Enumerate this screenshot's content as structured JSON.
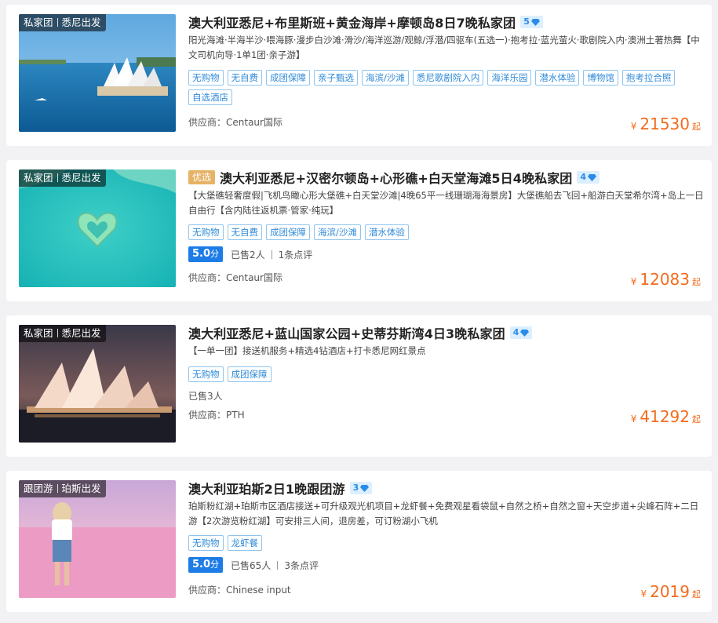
{
  "tours": [
    {
      "tag_type": "私家团",
      "tag_from": "悉尼出发",
      "title": "澳大利亚悉尼+布里斯班+黄金海岸+摩顿岛8日7晚私家团",
      "featured_label": "",
      "diamond": "5",
      "description": "阳光海滩·半海半沙·喂海豚·漫步白沙滩·滑沙/海洋巡游/观鲸/浮潜/四驱车(五选一)·抱考拉·蓝光萤火·歌剧院入内·澳洲土著热舞【中文司机向导·1单1团·亲子游】",
      "chips": [
        "无购物",
        "无自费",
        "成团保障",
        "亲子甄选",
        "海滨/沙滩",
        "悉尼歌剧院入内",
        "海洋乐园",
        "潜水体验",
        "博物馆",
        "抱考拉合照",
        "自选酒店"
      ],
      "score": "",
      "sold": "",
      "reviews": "",
      "supplier": "供应商：Centaur国际",
      "currency": "¥",
      "price": "21530",
      "price_suffix": "起"
    },
    {
      "tag_type": "私家团",
      "tag_from": "悉尼出发",
      "title": "澳大利亚悉尼+汉密尔顿岛+心形礁+白天堂海滩5日4晚私家团",
      "featured_label": "优选",
      "diamond": "4",
      "description": "【大堡礁轻奢度假|飞机鸟瞰心形大堡礁+白天堂沙滩|4晚65平一线珊瑚海海景房】大堡礁船去飞回+船游白天堂希尔湾+岛上一日自由行【含内陆往返机票·管家·纯玩】",
      "chips": [
        "无购物",
        "无自费",
        "成团保障",
        "海滨/沙滩",
        "潜水体验"
      ],
      "score": "5.0",
      "score_unit": "分",
      "sold": "已售2人",
      "reviews": "1条点评",
      "supplier": "供应商：Centaur国际",
      "currency": "¥",
      "price": "12083",
      "price_suffix": "起"
    },
    {
      "tag_type": "私家团",
      "tag_from": "悉尼出发",
      "title": "澳大利亚悉尼+蓝山国家公园+史蒂芬斯湾4日3晚私家团",
      "featured_label": "",
      "diamond": "4",
      "description": "【一单一团】接送机服务+精选4钻酒店+打卡悉尼网红景点",
      "chips": [
        "无购物",
        "成团保障"
      ],
      "score": "",
      "sold": "已售3人",
      "reviews": "",
      "supplier": "供应商：PTH",
      "currency": "¥",
      "price": "41292",
      "price_suffix": "起"
    },
    {
      "tag_type": "跟团游",
      "tag_from": "珀斯出发",
      "title": "澳大利亚珀斯2日1晚跟团游",
      "featured_label": "",
      "diamond": "3",
      "description": "珀斯粉红湖+珀斯市区酒店接送+可升级观光机项目+龙虾餐+免费观星看袋鼠+自然之桥+自然之窗+天空步道+尖峰石阵+二日游【2次游览粉红湖】可安排三人间，退房差，可订粉湖小飞机",
      "chips": [
        "无购物",
        "龙虾餐"
      ],
      "score": "5.0",
      "score_unit": "分",
      "sold": "已售65人",
      "reviews": "3条点评",
      "supplier": "供应商：Chinese input",
      "currency": "¥",
      "price": "2019",
      "price_suffix": "起"
    }
  ]
}
